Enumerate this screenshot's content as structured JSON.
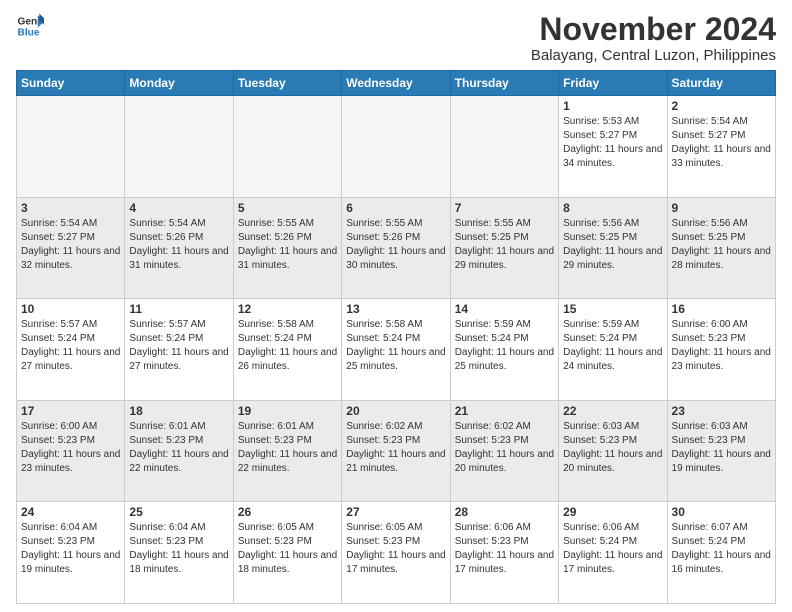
{
  "logo": {
    "line1": "General",
    "line2": "Blue"
  },
  "header": {
    "month": "November 2024",
    "location": "Balayang, Central Luzon, Philippines"
  },
  "weekdays": [
    "Sunday",
    "Monday",
    "Tuesday",
    "Wednesday",
    "Thursday",
    "Friday",
    "Saturday"
  ],
  "weeks": [
    [
      {
        "day": "",
        "empty": true
      },
      {
        "day": "",
        "empty": true
      },
      {
        "day": "",
        "empty": true
      },
      {
        "day": "",
        "empty": true
      },
      {
        "day": "",
        "empty": true
      },
      {
        "day": "1",
        "sunrise": "5:53 AM",
        "sunset": "5:27 PM",
        "daylight": "11 hours and 34 minutes."
      },
      {
        "day": "2",
        "sunrise": "5:54 AM",
        "sunset": "5:27 PM",
        "daylight": "11 hours and 33 minutes."
      }
    ],
    [
      {
        "day": "3",
        "sunrise": "5:54 AM",
        "sunset": "5:27 PM",
        "daylight": "11 hours and 32 minutes."
      },
      {
        "day": "4",
        "sunrise": "5:54 AM",
        "sunset": "5:26 PM",
        "daylight": "11 hours and 31 minutes."
      },
      {
        "day": "5",
        "sunrise": "5:55 AM",
        "sunset": "5:26 PM",
        "daylight": "11 hours and 31 minutes."
      },
      {
        "day": "6",
        "sunrise": "5:55 AM",
        "sunset": "5:26 PM",
        "daylight": "11 hours and 30 minutes."
      },
      {
        "day": "7",
        "sunrise": "5:55 AM",
        "sunset": "5:25 PM",
        "daylight": "11 hours and 29 minutes."
      },
      {
        "day": "8",
        "sunrise": "5:56 AM",
        "sunset": "5:25 PM",
        "daylight": "11 hours and 29 minutes."
      },
      {
        "day": "9",
        "sunrise": "5:56 AM",
        "sunset": "5:25 PM",
        "daylight": "11 hours and 28 minutes."
      }
    ],
    [
      {
        "day": "10",
        "sunrise": "5:57 AM",
        "sunset": "5:24 PM",
        "daylight": "11 hours and 27 minutes."
      },
      {
        "day": "11",
        "sunrise": "5:57 AM",
        "sunset": "5:24 PM",
        "daylight": "11 hours and 27 minutes."
      },
      {
        "day": "12",
        "sunrise": "5:58 AM",
        "sunset": "5:24 PM",
        "daylight": "11 hours and 26 minutes."
      },
      {
        "day": "13",
        "sunrise": "5:58 AM",
        "sunset": "5:24 PM",
        "daylight": "11 hours and 25 minutes."
      },
      {
        "day": "14",
        "sunrise": "5:59 AM",
        "sunset": "5:24 PM",
        "daylight": "11 hours and 25 minutes."
      },
      {
        "day": "15",
        "sunrise": "5:59 AM",
        "sunset": "5:24 PM",
        "daylight": "11 hours and 24 minutes."
      },
      {
        "day": "16",
        "sunrise": "6:00 AM",
        "sunset": "5:23 PM",
        "daylight": "11 hours and 23 minutes."
      }
    ],
    [
      {
        "day": "17",
        "sunrise": "6:00 AM",
        "sunset": "5:23 PM",
        "daylight": "11 hours and 23 minutes."
      },
      {
        "day": "18",
        "sunrise": "6:01 AM",
        "sunset": "5:23 PM",
        "daylight": "11 hours and 22 minutes."
      },
      {
        "day": "19",
        "sunrise": "6:01 AM",
        "sunset": "5:23 PM",
        "daylight": "11 hours and 22 minutes."
      },
      {
        "day": "20",
        "sunrise": "6:02 AM",
        "sunset": "5:23 PM",
        "daylight": "11 hours and 21 minutes."
      },
      {
        "day": "21",
        "sunrise": "6:02 AM",
        "sunset": "5:23 PM",
        "daylight": "11 hours and 20 minutes."
      },
      {
        "day": "22",
        "sunrise": "6:03 AM",
        "sunset": "5:23 PM",
        "daylight": "11 hours and 20 minutes."
      },
      {
        "day": "23",
        "sunrise": "6:03 AM",
        "sunset": "5:23 PM",
        "daylight": "11 hours and 19 minutes."
      }
    ],
    [
      {
        "day": "24",
        "sunrise": "6:04 AM",
        "sunset": "5:23 PM",
        "daylight": "11 hours and 19 minutes."
      },
      {
        "day": "25",
        "sunrise": "6:04 AM",
        "sunset": "5:23 PM",
        "daylight": "11 hours and 18 minutes."
      },
      {
        "day": "26",
        "sunrise": "6:05 AM",
        "sunset": "5:23 PM",
        "daylight": "11 hours and 18 minutes."
      },
      {
        "day": "27",
        "sunrise": "6:05 AM",
        "sunset": "5:23 PM",
        "daylight": "11 hours and 17 minutes."
      },
      {
        "day": "28",
        "sunrise": "6:06 AM",
        "sunset": "5:23 PM",
        "daylight": "11 hours and 17 minutes."
      },
      {
        "day": "29",
        "sunrise": "6:06 AM",
        "sunset": "5:24 PM",
        "daylight": "11 hours and 17 minutes."
      },
      {
        "day": "30",
        "sunrise": "6:07 AM",
        "sunset": "5:24 PM",
        "daylight": "11 hours and 16 minutes."
      }
    ]
  ]
}
